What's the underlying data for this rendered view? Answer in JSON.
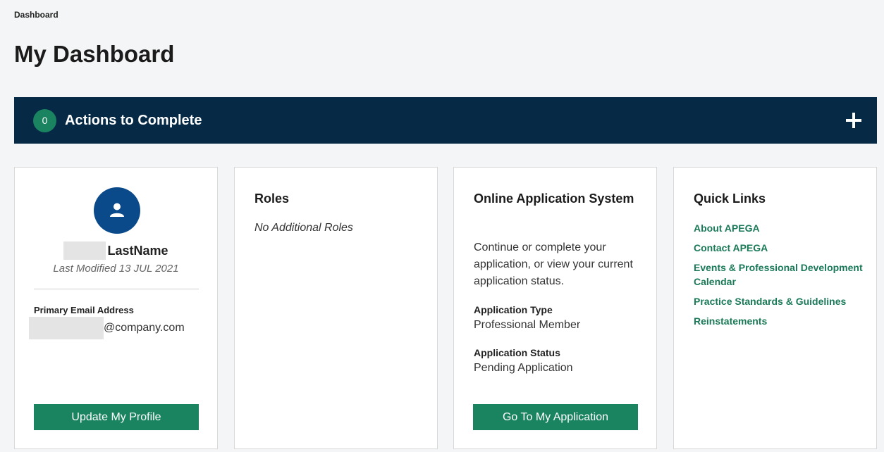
{
  "breadcrumb": "Dashboard",
  "page_title": "My Dashboard",
  "actions": {
    "count": "0",
    "label": "Actions to Complete"
  },
  "profile": {
    "name": "LastName",
    "last_modified": "Last Modified 13 JUL 2021",
    "email_label": "Primary Email Address",
    "email": "@company.com",
    "button_label": "Update My Profile"
  },
  "roles": {
    "title": "Roles",
    "empty_text": "No Additional Roles"
  },
  "oas": {
    "title": "Online Application System",
    "description": "Continue or complete your application, or view your current application status.",
    "type_label": "Application Type",
    "type_value": "Professional Member",
    "status_label": "Application Status",
    "status_value": "Pending Application",
    "button_label": "Go To My Application"
  },
  "quick_links": {
    "title": "Quick Links",
    "items": [
      {
        "label": "About APEGA"
      },
      {
        "label": "Contact APEGA"
      },
      {
        "label": "Events & Professional Development Calendar"
      },
      {
        "label": "Practice Standards & Guidelines"
      },
      {
        "label": "Reinstatements"
      }
    ]
  },
  "colors": {
    "accent": "#1a8360",
    "banner": "#062946",
    "avatar": "#0b4a8a",
    "link": "#1a7a57"
  }
}
